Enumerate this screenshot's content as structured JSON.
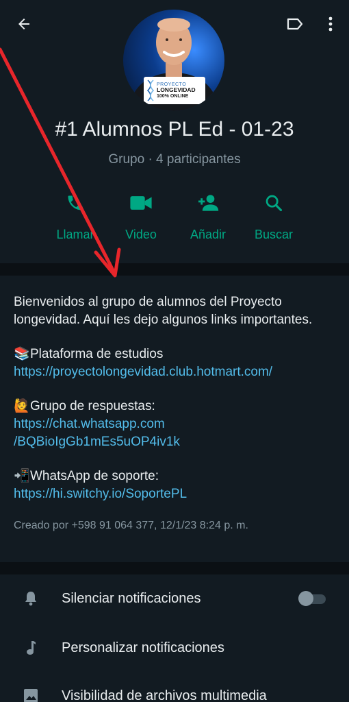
{
  "header": {
    "title": "#1 Alumnos PL Ed - 01-23",
    "subtitle": "Grupo · 4 participantes",
    "avatar_logo": {
      "line1": "PROYECTO",
      "line2": "LONGEVIDAD",
      "line3": "100% ONLINE"
    }
  },
  "actions": [
    {
      "label": "Llamar",
      "icon": "phone-icon"
    },
    {
      "label": "Video",
      "icon": "videocam-icon"
    },
    {
      "label": "Añadir",
      "icon": "add-person-icon"
    },
    {
      "label": "Buscar",
      "icon": "search-icon"
    }
  ],
  "description": {
    "intro": "Bienvenidos al grupo de alumnos del Proyecto longevidad. Aquí les dejo algunos links importantes.",
    "item1": {
      "emoji": "📚",
      "label": "Plataforma de estudios",
      "link": "https://proyectolongevidad.club.hotmart.com/"
    },
    "item2": {
      "emoji": "🙋",
      "label": "Grupo de respuestas:",
      "link1": "https://chat.whatsapp.com",
      "link2": "/BQBioIgGb1mEs5uOP4iv1k"
    },
    "item3": {
      "emoji": "📲",
      "label": "WhatsApp de soporte:",
      "link": "https://hi.switchy.io/SoportePL"
    },
    "created": "Creado por +598 91 064 377, 12/1/23 8:24 p. m."
  },
  "settings": [
    {
      "label": "Silenciar notificaciones",
      "icon": "bell-icon",
      "toggle_on": false
    },
    {
      "label": "Personalizar notificaciones",
      "icon": "music-note-icon"
    },
    {
      "label": "Visibilidad de archivos multimedia",
      "icon": "image-icon"
    }
  ],
  "colors": {
    "background": "#121b22",
    "accent": "#00a884",
    "link": "#53bdeb",
    "secondary_text": "#8696a0",
    "annotation_arrow": "#e8262b"
  }
}
